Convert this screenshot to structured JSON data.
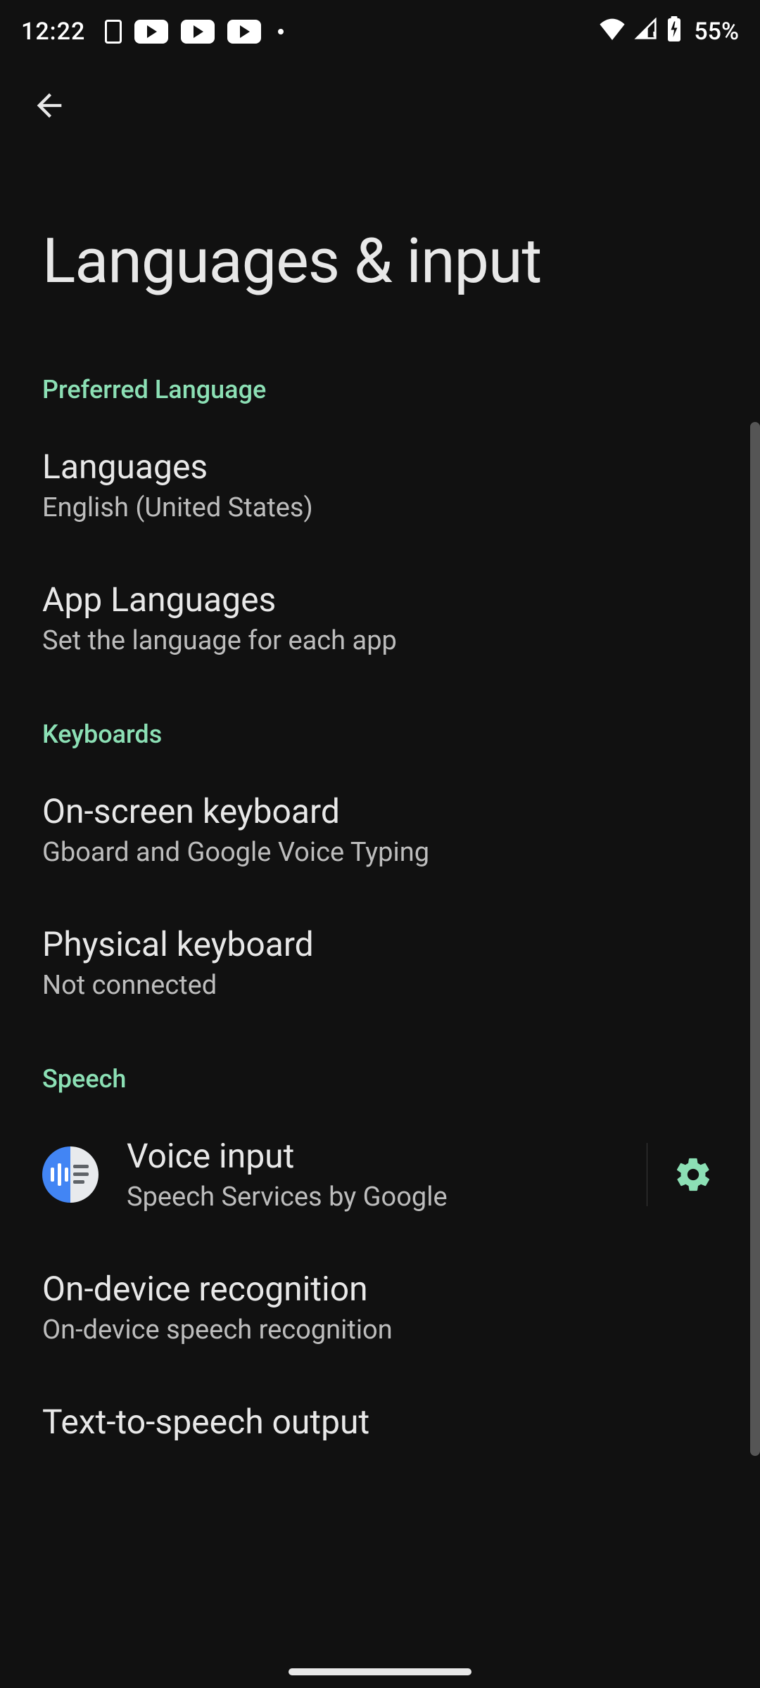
{
  "statusbar": {
    "time": "12:22",
    "battery": "55%"
  },
  "page": {
    "title": "Languages & input"
  },
  "sections": {
    "preferred": {
      "header": "Preferred Language",
      "languages": {
        "title": "Languages",
        "subtitle": "English (United States)"
      },
      "app_languages": {
        "title": "App Languages",
        "subtitle": "Set the language for each app"
      }
    },
    "keyboards": {
      "header": "Keyboards",
      "onscreen": {
        "title": "On-screen keyboard",
        "subtitle": "Gboard and Google Voice Typing"
      },
      "physical": {
        "title": "Physical keyboard",
        "subtitle": "Not connected"
      }
    },
    "speech": {
      "header": "Speech",
      "voice_input": {
        "title": "Voice input",
        "subtitle": "Speech Services by Google"
      },
      "on_device": {
        "title": "On-device recognition",
        "subtitle": "On-device speech recognition"
      },
      "tts": {
        "title": "Text-to-speech output"
      }
    }
  }
}
